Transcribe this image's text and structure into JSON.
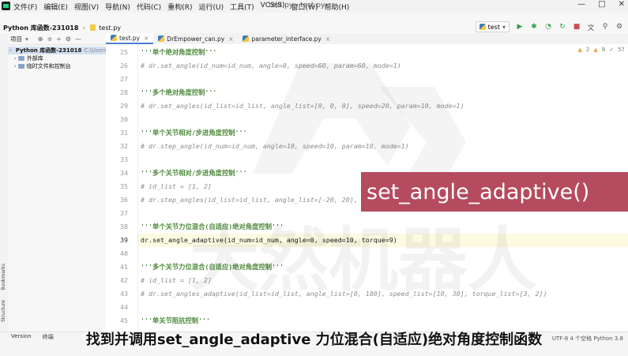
{
  "menubar": {
    "items": [
      "文件(F)",
      "编辑(E)",
      "视图(V)",
      "导航(N)",
      "代码(C)",
      "重构(R)",
      "运行(U)",
      "工具(T)",
      "VCS(S)",
      "窗口(W)",
      "帮助(H)"
    ],
    "title": "test.py - test.py",
    "window_controls": [
      "—",
      "□",
      "✕"
    ]
  },
  "navbar": {
    "breadcrumb": [
      "Python 库函数-231018",
      "test.py"
    ],
    "run_config": "test"
  },
  "project_panel": {
    "header_label": "项目",
    "tree": [
      {
        "label": "Python 库函数-231018",
        "path": "C:\\Users\\"
      },
      {
        "label": "外部库",
        "path": ""
      },
      {
        "label": "临时文件和控制台",
        "path": ""
      }
    ]
  },
  "tabs": [
    {
      "label": "test.py",
      "active": true
    },
    {
      "label": "DrEmpower_can.py",
      "active": false
    },
    {
      "label": "parameter_interface.py",
      "active": false
    }
  ],
  "inspections": {
    "warnings": "2",
    "weak": "8",
    "typos": "57"
  },
  "editor": {
    "lines": [
      {
        "n": "25",
        "type": "doc",
        "text": "'''单个绝对角度控制'''"
      },
      {
        "n": "26",
        "type": "comment",
        "text": "# dr.set_angle(id_num=id_num, angle=0, speed=60, param=60, mode=1)"
      },
      {
        "n": "27",
        "type": "blank",
        "text": ""
      },
      {
        "n": "28",
        "type": "doc",
        "text": "'''多个绝对角度控制'''"
      },
      {
        "n": "29",
        "type": "comment",
        "text": "# dr.set_angles(id_list=id_list, angle_list=[0, 0, 0], speed=20, param=10, mode=1)"
      },
      {
        "n": "30",
        "type": "blank",
        "text": ""
      },
      {
        "n": "31",
        "type": "doc",
        "text": "'''单个关节相对/步进角度控制'''"
      },
      {
        "n": "32",
        "type": "comment",
        "text": "# dr.step_angle(id_num=id_num, angle=10, speed=10, param=10, mode=1)"
      },
      {
        "n": "33",
        "type": "blank",
        "text": ""
      },
      {
        "n": "34",
        "type": "doc",
        "text": "'''多个关节相对/步进角度控制'''"
      },
      {
        "n": "35",
        "type": "comment",
        "text": "# id_list = [1, 2]"
      },
      {
        "n": "36",
        "type": "comment",
        "text": "# dr.step_angles(id_list=id_list, angle_list=[-20, 20], speed=10, param=10, mode=1)"
      },
      {
        "n": "37",
        "type": "blank",
        "text": ""
      },
      {
        "n": "38",
        "type": "doc",
        "text": "'''单个关节力位混合(自适应)绝对角度控制'''"
      },
      {
        "n": "39",
        "type": "code",
        "text": "dr.set_angle_adaptive(id_num=id_num, angle=0, speed=10, torque=9)"
      },
      {
        "n": "40",
        "type": "blank",
        "text": ""
      },
      {
        "n": "41",
        "type": "doc",
        "text": "'''多个关节力位混合(自适应)绝对角度控制'''"
      },
      {
        "n": "42",
        "type": "comment",
        "text": "# id_list = [1, 2]"
      },
      {
        "n": "43",
        "type": "comment",
        "text": "# dr.set_angles_adaptive(id_list=id_list, angle_list=[0, 180], speed_list=[10, 30], torque_list=[3, 2])"
      },
      {
        "n": "44",
        "type": "blank",
        "text": ""
      },
      {
        "n": "45",
        "type": "doc",
        "text": "'''单关节阻抗控制'''"
      },
      {
        "n": "46",
        "type": "comment",
        "text": "# dr.impedance_control(id_num=id_num, angle=20, speed=2, tff=1, kp=1, kd=1)"
      },
      {
        "n": "47",
        "type": "blank",
        "text": ""
      }
    ],
    "current_line": "39"
  },
  "overlay": {
    "label": "set_angle_adaptive()"
  },
  "watermark": {
    "text": "大然机器人"
  },
  "left_strip": {
    "labels": [
      "Bookmarks",
      "Structure"
    ]
  },
  "bottom": {
    "tabs": [
      "Version",
      "终端"
    ],
    "status": "UTF-8  4 个空格  Python 3.8"
  },
  "subtitle": "找到并调用set_angle_adaptive 力位混合(自适应)绝对角度控制函数",
  "colors": {
    "overlay_bg": "#b54b5e",
    "active_tab_underline": "#4a7fd0",
    "docstring": "#4f8a3c",
    "comment": "#8c8c8c"
  }
}
